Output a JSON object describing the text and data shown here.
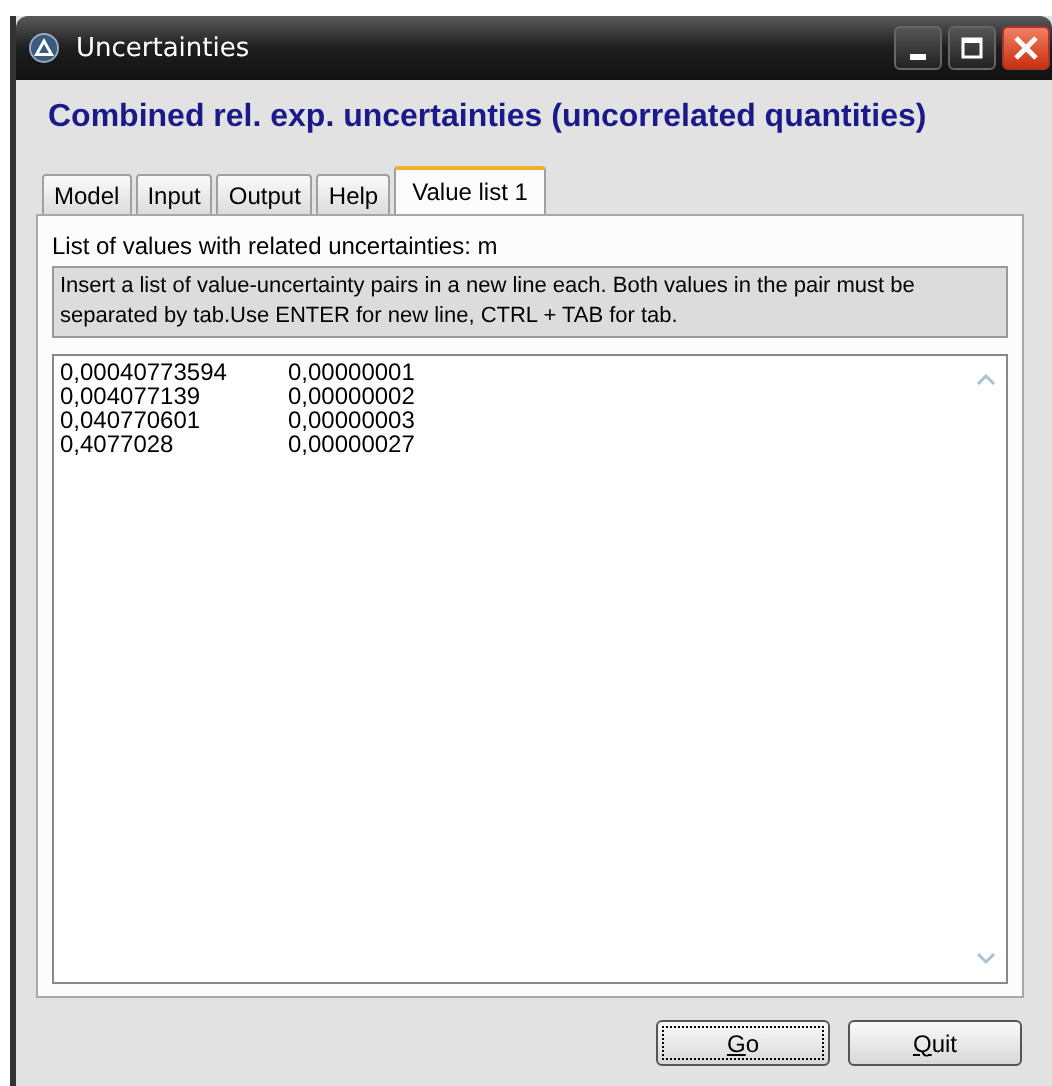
{
  "window": {
    "title": "Uncertainties"
  },
  "heading": "Combined rel. exp. uncertainties (uncorrelated quantities)",
  "tabs": [
    {
      "label": "Model",
      "selected": false
    },
    {
      "label": "Input",
      "selected": false
    },
    {
      "label": "Output",
      "selected": false
    },
    {
      "label": "Help",
      "selected": false
    },
    {
      "label": "Value list 1",
      "selected": true
    }
  ],
  "list_label": "List of values with related uncertainties: m",
  "hint": "Insert a list of value-uncertainty pairs in a new line each. Both values in the pair must be separated by tab.Use ENTER for new line, CTRL + TAB for tab.",
  "values": [
    [
      "0,00040773594",
      "0,00000001"
    ],
    [
      "0,004077139",
      "0,00000002"
    ],
    [
      "0,040770601",
      "0,00000003"
    ],
    [
      "0,4077028",
      "0,00000027"
    ]
  ],
  "buttons": [
    {
      "label": "Go",
      "focused": true
    },
    {
      "label": "Quit",
      "focused": false
    }
  ]
}
